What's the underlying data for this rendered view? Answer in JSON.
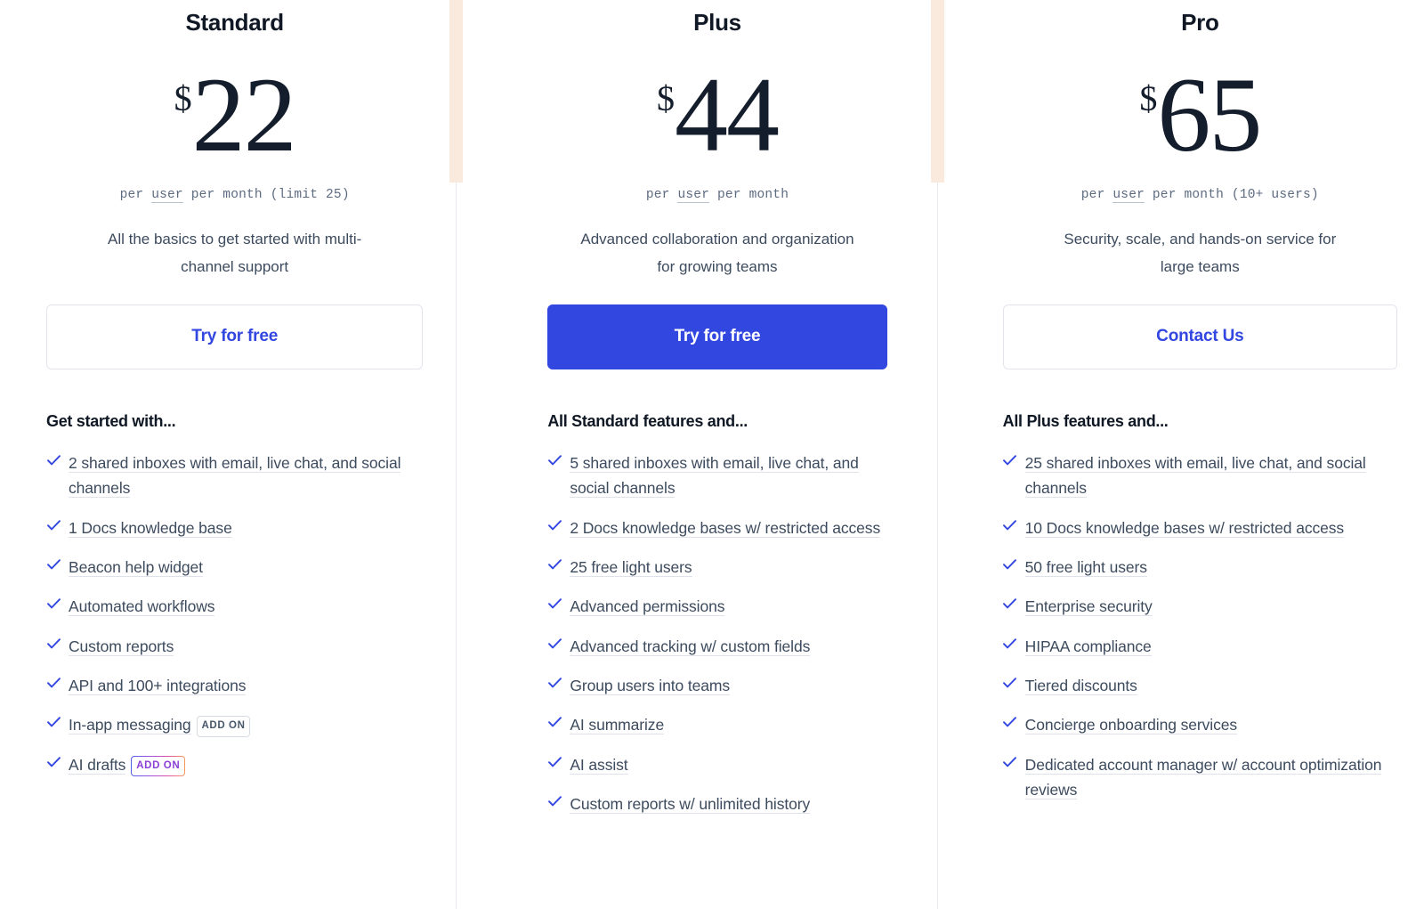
{
  "accent_color": "#3246e0",
  "accent_band_color": "#faeade",
  "plans": [
    {
      "name": "Standard",
      "currency": "$",
      "amount": "22",
      "price_note_prefix": "per ",
      "price_note_tip": "user",
      "price_note_suffix": " per month (limit 25)",
      "tagline": "All the basics to get started with multi-channel support",
      "cta_label": "Try for free",
      "cta_style": "outline",
      "features_title": "Get started with...",
      "features": [
        {
          "text": "2 shared inboxes with email, live chat, and social channels"
        },
        {
          "text": "1 Docs knowledge base"
        },
        {
          "text": "Beacon help widget"
        },
        {
          "text": "Automated workflows"
        },
        {
          "text": "Custom reports"
        },
        {
          "text": "API and 100+ integrations"
        },
        {
          "text": "In-app messaging",
          "badge": "ADD ON",
          "badge_style": "gray"
        },
        {
          "text": "AI drafts",
          "badge": "ADD ON",
          "badge_style": "ai"
        }
      ]
    },
    {
      "name": "Plus",
      "currency": "$",
      "amount": "44",
      "price_note_prefix": "per ",
      "price_note_tip": "user",
      "price_note_suffix": " per month",
      "tagline": "Advanced collaboration and organization for growing teams",
      "cta_label": "Try for free",
      "cta_style": "solid",
      "features_title": "All Standard features and...",
      "features": [
        {
          "text": "5 shared inboxes with email, live chat, and social channels"
        },
        {
          "text": "2 Docs knowledge bases w/ restricted access"
        },
        {
          "text": "25 free light users"
        },
        {
          "text": "Advanced permissions"
        },
        {
          "text": "Advanced tracking w/ custom fields"
        },
        {
          "text": "Group users into teams"
        },
        {
          "text": "AI summarize"
        },
        {
          "text": "AI assist"
        },
        {
          "text": "Custom reports w/ unlimited history"
        }
      ]
    },
    {
      "name": "Pro",
      "currency": "$",
      "amount": "65",
      "price_note_prefix": "per ",
      "price_note_tip": "user",
      "price_note_suffix": " per month (10+ users)",
      "tagline": "Security, scale, and hands-on service for large teams",
      "cta_label": "Contact Us",
      "cta_style": "outline",
      "features_title": "All Plus features and...",
      "features": [
        {
          "text": "25 shared inboxes with email, live chat, and social channels"
        },
        {
          "text": "10 Docs knowledge bases w/ restricted access"
        },
        {
          "text": "50 free light users"
        },
        {
          "text": "Enterprise security"
        },
        {
          "text": "HIPAA compliance"
        },
        {
          "text": "Tiered discounts"
        },
        {
          "text": "Concierge onboarding services"
        },
        {
          "text": "Dedicated account manager w/ account optimization reviews"
        }
      ]
    }
  ]
}
